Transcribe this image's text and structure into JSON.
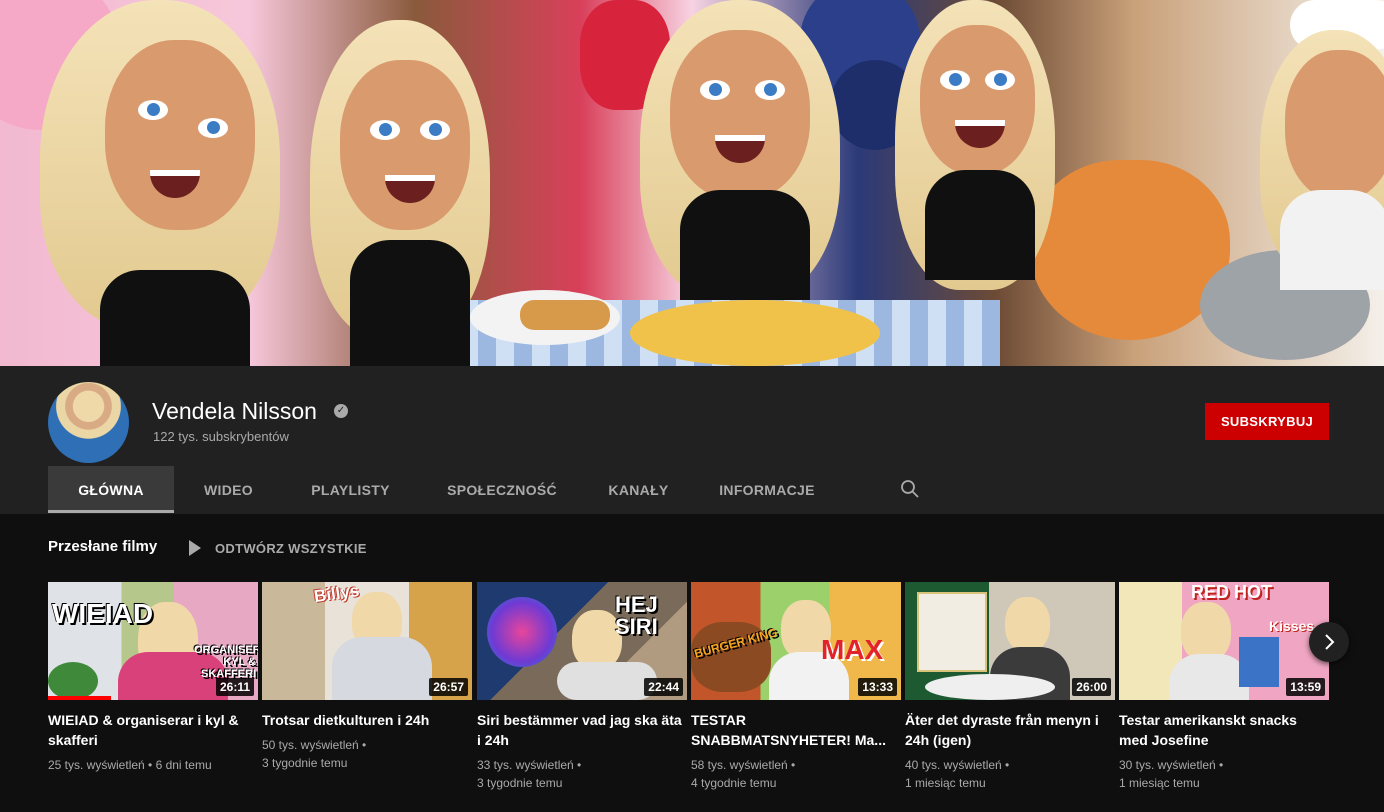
{
  "channel": {
    "name": "Vendela Nilsson",
    "subscribers": "122 tys. subskrybentów",
    "subscribe_label": "SUBSKRYBUJ",
    "verified_glyph": "✓"
  },
  "tabs": [
    {
      "label": "GŁÓWNA",
      "active": true
    },
    {
      "label": "WIDEO",
      "active": false
    },
    {
      "label": "PLAYLISTY",
      "active": false
    },
    {
      "label": "SPOŁECZNOŚĆ",
      "active": false
    },
    {
      "label": "KANAŁY",
      "active": false
    },
    {
      "label": "INFORMACJE",
      "active": false
    }
  ],
  "shelf": {
    "title": "Przesłane filmy",
    "play_all": "ODTWÓRZ WSZYSTKIE"
  },
  "videos": [
    {
      "title": "WIEIAD & organiserar i kyl & skafferi",
      "views": "25 tys. wyświetleń",
      "age": "6 dni temu",
      "duration": "26:11",
      "thumb_text": "WIEIAD",
      "thumb_text2": "ORGANISERAR KYL & SKAFFERI",
      "progress": 0.3
    },
    {
      "title": "Trotsar dietkulturen i 24h",
      "views": "50 tys. wyświetleń",
      "age": "3 tygodnie temu",
      "duration": "26:57",
      "thumb_text": "Billys"
    },
    {
      "title": "Siri bestämmer vad jag ska äta i 24h",
      "views": "33 tys. wyświetleń",
      "age": "3 tygodnie temu",
      "duration": "22:44",
      "thumb_text": "HEJ SIRI"
    },
    {
      "title": "TESTAR SNABBMATSNYHETER! Ma...",
      "views": "58 tys. wyświetleń",
      "age": "4 tygodnie temu",
      "duration": "13:33",
      "thumb_text": "BURGER KING",
      "thumb_text2": "MAX"
    },
    {
      "title": "Äter det dyraste från menyn i 24h (igen)",
      "views": "40 tys. wyświetleń",
      "age": "1 miesiąc temu",
      "duration": "26:00"
    },
    {
      "title": "Testar amerikanskt snacks med Josefine",
      "views": "30 tys. wyświetleń",
      "age": "1 miesiąc temu",
      "duration": "13:59",
      "thumb_text": "RED HOT",
      "thumb_text2": "Kisses"
    }
  ],
  "icons": {
    "search": "search-icon",
    "play": "play-icon",
    "next": "chevron-right-icon",
    "verified": "verified-icon"
  },
  "colors": {
    "subscribe": "#cc0000",
    "header_bg": "#212121",
    "page_bg": "#0f0f0f",
    "progress": "#ff0000"
  }
}
